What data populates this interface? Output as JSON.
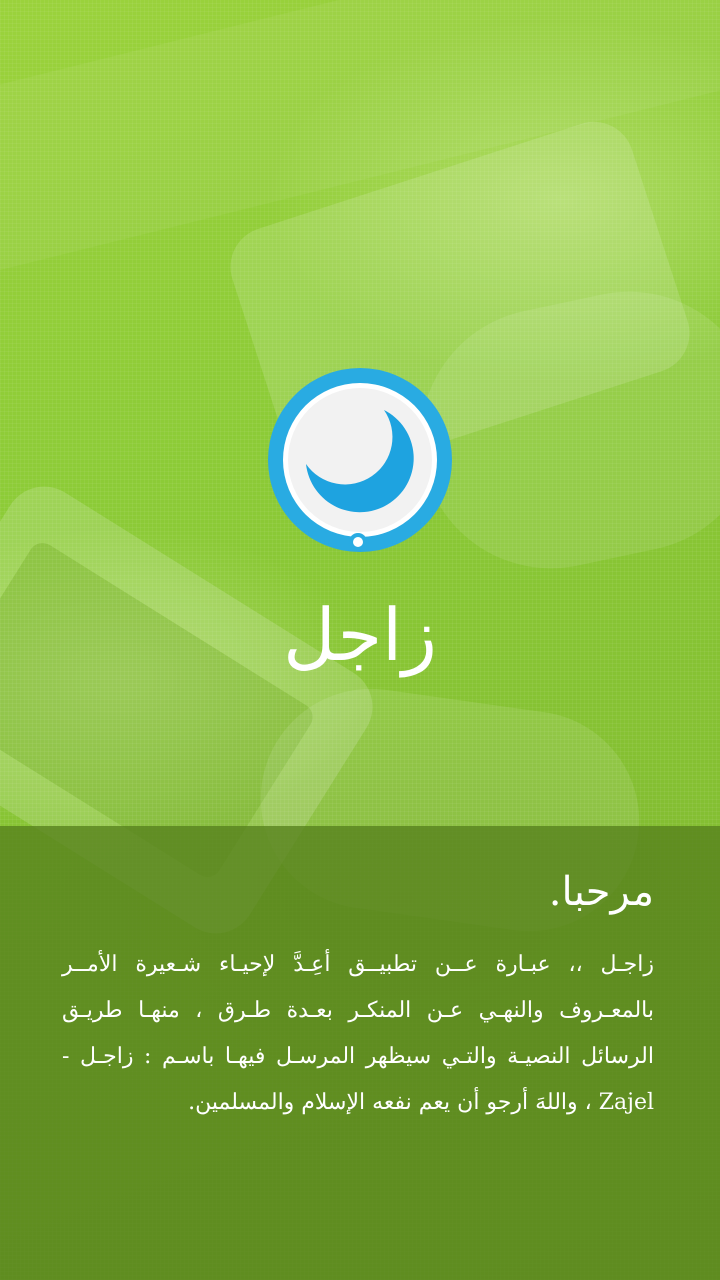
{
  "app": {
    "title": "زاجل"
  },
  "logo": {
    "icon": "crescent-bubble-icon",
    "ring_color": "#29abe2",
    "inner_color": "#f2f2f2",
    "crescent_color": "#1ea3e0"
  },
  "welcome": {
    "title": "مرحبا.",
    "body": "زاجـل ،، عبـارة عــن تطبيــق أعِـدَّ لإحيـاء شـعيرة الأمــر بالمعـروف والنهـي عـن المنكـر بعـدة طـرق ، منهـا طريـق الرسائل النصيـة والتـي سيظهر المرسـل فيهـا باسـم : زاجـل - Zajel ، واللهَ أرجو أن يعم نفعه الإسلام والمسلمين."
  },
  "colors": {
    "background": "#8cc63f",
    "panel": "#56801c",
    "text": "#ffffff"
  }
}
